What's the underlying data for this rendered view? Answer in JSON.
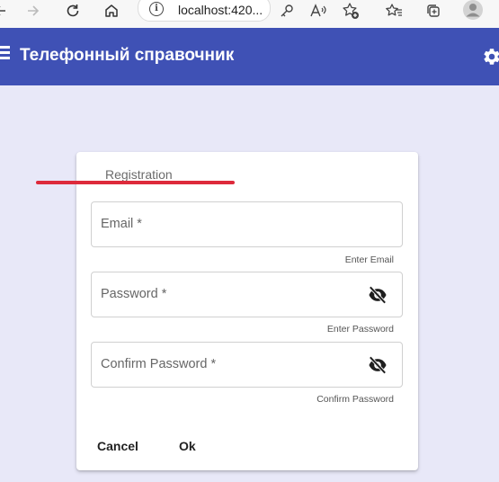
{
  "browser": {
    "url": "localhost:420...",
    "info_glyph": "i"
  },
  "app": {
    "title": "Телефонный справочник",
    "toolbar_color": "#3f51b5"
  },
  "form": {
    "title": "Registration",
    "fields": [
      {
        "label": "Email *",
        "hint": "Enter Email",
        "has_toggle": false
      },
      {
        "label": "Password *",
        "hint": "Enter Password",
        "has_toggle": true
      },
      {
        "label": "Confirm Password *",
        "hint": "Confirm Password",
        "has_toggle": true
      }
    ],
    "cancel_label": "Cancel",
    "ok_label": "Ok"
  },
  "icons": [
    "back-icon",
    "forward-icon",
    "refresh-icon",
    "home-icon",
    "info-icon",
    "key-icon",
    "read-aloud-icon",
    "add-favorite-icon",
    "favorites-icon",
    "collections-icon",
    "profile-icon",
    "menu-icon",
    "gear-icon",
    "visibility-off-icon"
  ],
  "colors": {
    "background": "#e8e8f8",
    "annotation": "#dd2a3b"
  }
}
